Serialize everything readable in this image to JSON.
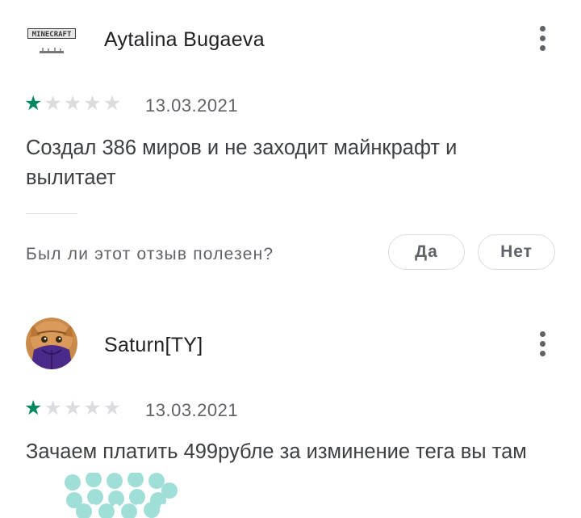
{
  "reviews": [
    {
      "author": "Aytalina Bugaeva",
      "avatar_icon": "minecraft-logo-avatar",
      "avatar_logo_text": "MINECRAFT",
      "rating": 1,
      "max_rating": 5,
      "date": "13.03.2021",
      "text": "Создал 386 миров и не заходит майнкрафт и вылитает",
      "helpful_question": "Был ли этот отзыв полезен?",
      "yes_label": "Да",
      "no_label": "Нет"
    },
    {
      "author": "Saturn[TY]",
      "avatar_icon": "cat-photo-avatar",
      "rating": 1,
      "max_rating": 5,
      "date": "13.03.2021",
      "text": "Зачаем платить 499рубле за изминение тега вы там"
    }
  ],
  "colors": {
    "star_active": "#01875f",
    "star_inactive": "#dadce0",
    "text_primary": "#202124",
    "text_secondary": "#5f6368",
    "redaction_mark": "#9fdfd7"
  }
}
